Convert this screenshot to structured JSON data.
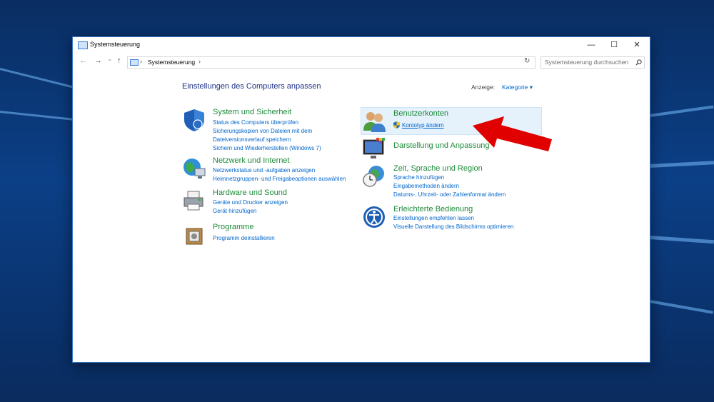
{
  "window": {
    "title": "Systemsteuerung",
    "controls": {
      "minimize": "—",
      "maximize": "☐",
      "close": "✕"
    }
  },
  "address_bar": {
    "back": "←",
    "forward": "→",
    "recent": "⌄",
    "up": "↑",
    "path": "Systemsteuerung",
    "separator": "›",
    "refresh": "↻",
    "search_placeholder": "Systemsteuerung durchsuchen"
  },
  "main": {
    "heading": "Einstellungen des Computers anpassen",
    "view_label": "Anzeige:",
    "view_value": "Kategorie ▾"
  },
  "categories": {
    "system": {
      "title": "System und Sicherheit",
      "links": [
        "Status des Computers überprüfen",
        "Sicherungskopien von Dateien mit dem Dateiversionsverlauf speichern",
        "Sichern und Wiederherstellen (Windows 7)"
      ],
      "link1a": "Status des Computers überprüfen",
      "link2a": "Sicherungskopien von Dateien mit dem",
      "link2b": "Dateiversionsverlauf speichern",
      "link3": "Sichern und Wiederherstellen (Windows 7)"
    },
    "network": {
      "title": "Netzwerk und Internet",
      "link1": "Netzwerkstatus und -aufgaben anzeigen",
      "link2": "Heimnetzgruppen- und Freigabeoptionen auswählen"
    },
    "hardware": {
      "title": "Hardware und Sound",
      "link1": "Geräte und Drucker anzeigen",
      "link2": "Gerät hinzufügen"
    },
    "programs": {
      "title": "Programme",
      "link1": "Programm deinstallieren"
    },
    "accounts": {
      "title": "Benutzerkonten",
      "link1": "Kontotyp ändern"
    },
    "appearance": {
      "title": "Darstellung und Anpassung"
    },
    "region": {
      "title": "Zeit, Sprache und Region",
      "link1": "Sprache hinzufügen",
      "link2": "Eingabemethoden ändern",
      "link3": "Datums-, Uhrzeit- oder Zahlenformat ändern"
    },
    "access": {
      "title": "Erleichterte Bedienung",
      "link1": "Einstellungen empfehlen lassen",
      "link2": "Visuelle Darstellung des Bildschirms optimieren"
    }
  },
  "icons": {
    "shield": "shield-icon",
    "network": "globe-network-icon",
    "hardware": "printer-icon",
    "programs": "program-box-icon",
    "accounts": "users-icon",
    "appearance": "monitor-palette-icon",
    "region": "clock-globe-icon",
    "access": "accessibility-icon"
  },
  "colors": {
    "category_title": "#1e8b3a",
    "link": "#0066cc",
    "heading": "#1e3287",
    "highlight": "#e5f1fb",
    "annotation_arrow": "#e00000"
  }
}
